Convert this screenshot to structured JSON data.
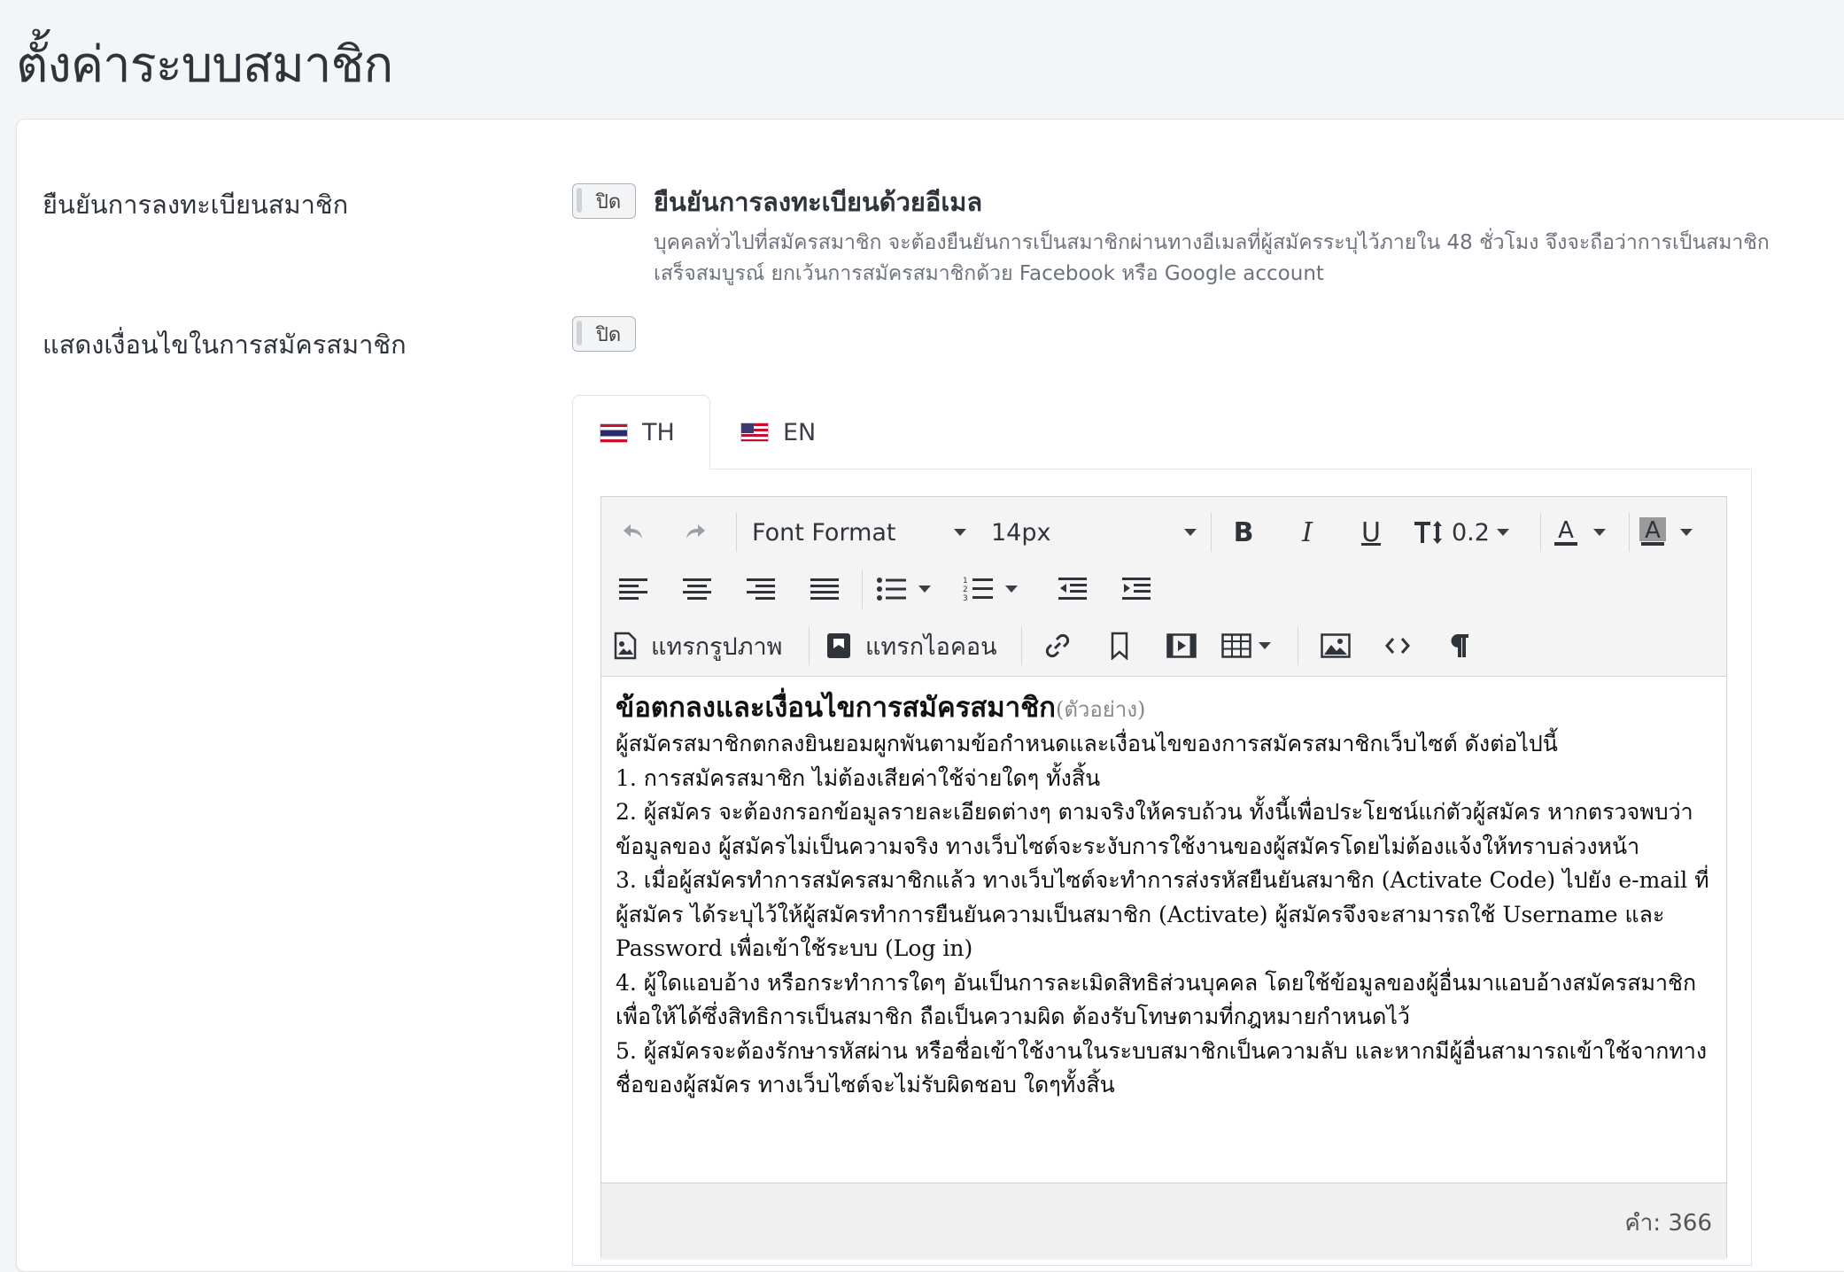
{
  "page": {
    "title": "ตั้งค่าระบบสมาชิก"
  },
  "settings": {
    "email_verification": {
      "label": "ยืนยันการลงทะเบียนสมาชิก",
      "toggle": "ปิด",
      "option_title": "ยืนยันการลงทะเบียนด้วยอีเมล",
      "description": "บุคคลทั่วไปที่สมัครสมาชิก จะต้องยืนยันการเป็นสมาชิกผ่านทางอีเมลที่ผู้สมัครระบุไว้ภายใน 48 ชั่วโมง จึงจะถือว่าการเป็นสมาชิกเสร็จสมบูรณ์ ยกเว้นการสมัครสมาชิกด้วย Facebook หรือ Google account"
    },
    "show_terms": {
      "label": "แสดงเงื่อนไขในการสมัครสมาชิก",
      "toggle": "ปิด"
    }
  },
  "tabs": [
    {
      "label": "TH",
      "flag": "thailand-flag-icon",
      "active": true
    },
    {
      "label": "EN",
      "flag": "usa-flag-icon",
      "active": false
    }
  ],
  "editor": {
    "toolbar": {
      "font_format": "Font Format",
      "font_size": "14px",
      "line_height": "0.2",
      "insert_image": "แทรกรูปภาพ",
      "insert_icon": "แทรกไอคอน"
    },
    "content": {
      "heading": "ข้อตกลงและเงื่อนไขการสมัครสมาชิก",
      "heading_note": "(ตัวอย่าง)",
      "paragraphs": [
        "ผู้สมัครสมาชิกตกลงยินยอมผูกพันตามข้อกำหนดและเงื่อนไขของการสมัครสมาชิกเว็บไซต์ ดังต่อไปนี้",
        "1. การสมัครสมาชิก ไม่ต้องเสียค่าใช้จ่ายใดๆ ทั้งสิ้น",
        "2. ผู้สมัคร จะต้องกรอกข้อมูลรายละเอียดต่างๆ ตามจริงให้ครบถ้วน ทั้งนี้เพื่อประโยชน์แก่ตัวผู้สมัคร หากตรวจพบว่า ข้อมูลของ ผู้สมัครไม่เป็นความจริง ทางเว็บไซต์จะระงับการใช้งานของผู้สมัครโดยไม่ต้องแจ้งให้ทราบล่วงหน้า",
        "3. เมื่อผู้สมัครทำการสมัครสมาชิกแล้ว ทางเว็บไซต์จะทำการส่งรหัสยืนยันสมาชิก (Activate Code) ไปยัง e-mail ที่ ผู้สมัคร ได้ระบุไว้ให้ผู้สมัครทำการยืนยันความเป็นสมาชิก (Activate) ผู้สมัครจึงจะสามารถใช้ Username และ Password เพื่อเข้าใช้ระบบ (Log in)",
        "4. ผู้ใดแอบอ้าง หรือกระทำการใดๆ อันเป็นการละเมิดสิทธิส่วนบุคคล โดยใช้ข้อมูลของผู้อื่นมาแอบอ้างสมัครสมาชิก เพื่อให้ได้ซึ่งสิทธิการเป็นสมาชิก ถือเป็นความผิด ต้องรับโทษตามที่กฎหมายกำหนดไว้",
        "5. ผู้สมัครจะต้องรักษารหัสผ่าน หรือชื่อเข้าใช้งานในระบบสมาชิกเป็นความลับ และหากมีผู้อื่นสามารถเข้าใช้จากทาง ชื่อของผู้สมัคร ทางเว็บไซต์จะไม่รับผิดชอบ ใดๆทั้งสิ้น"
      ]
    },
    "word_count": "คำ: 366"
  }
}
